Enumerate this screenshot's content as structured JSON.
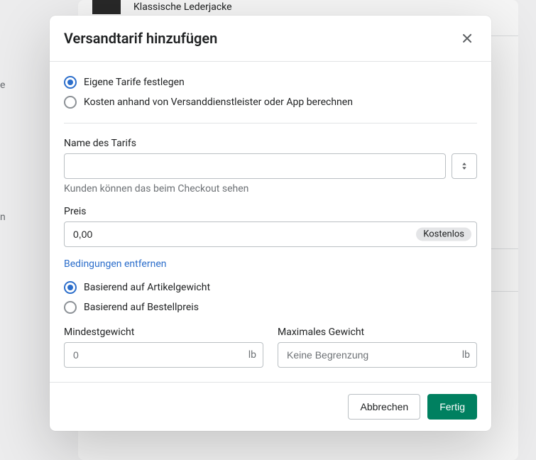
{
  "background": {
    "product_name": "Klassische Lederjacke",
    "side_e": "e",
    "side_n": "n"
  },
  "modal": {
    "title": "Versandtarif hinzufügen",
    "rate_type": {
      "custom": "Eigene Tarife festlegen",
      "carrier": "Kosten anhand von Versanddienstleister oder App berechnen"
    },
    "rate_name": {
      "label": "Name des Tarifs",
      "value": "",
      "helper": "Kunden können das beim Checkout sehen"
    },
    "price": {
      "label": "Preis",
      "value": "0,00",
      "badge": "Kostenlos"
    },
    "remove_conditions": "Bedingungen entfernen",
    "condition_type": {
      "weight": "Basierend auf Artikelgewicht",
      "price": "Basierend auf Bestellpreis"
    },
    "min_weight": {
      "label": "Mindestgewicht",
      "placeholder": "0",
      "unit": "lb"
    },
    "max_weight": {
      "label": "Maximales Gewicht",
      "placeholder": "Keine Begrenzung",
      "unit": "lb"
    },
    "cancel": "Abbrechen",
    "done": "Fertig"
  }
}
